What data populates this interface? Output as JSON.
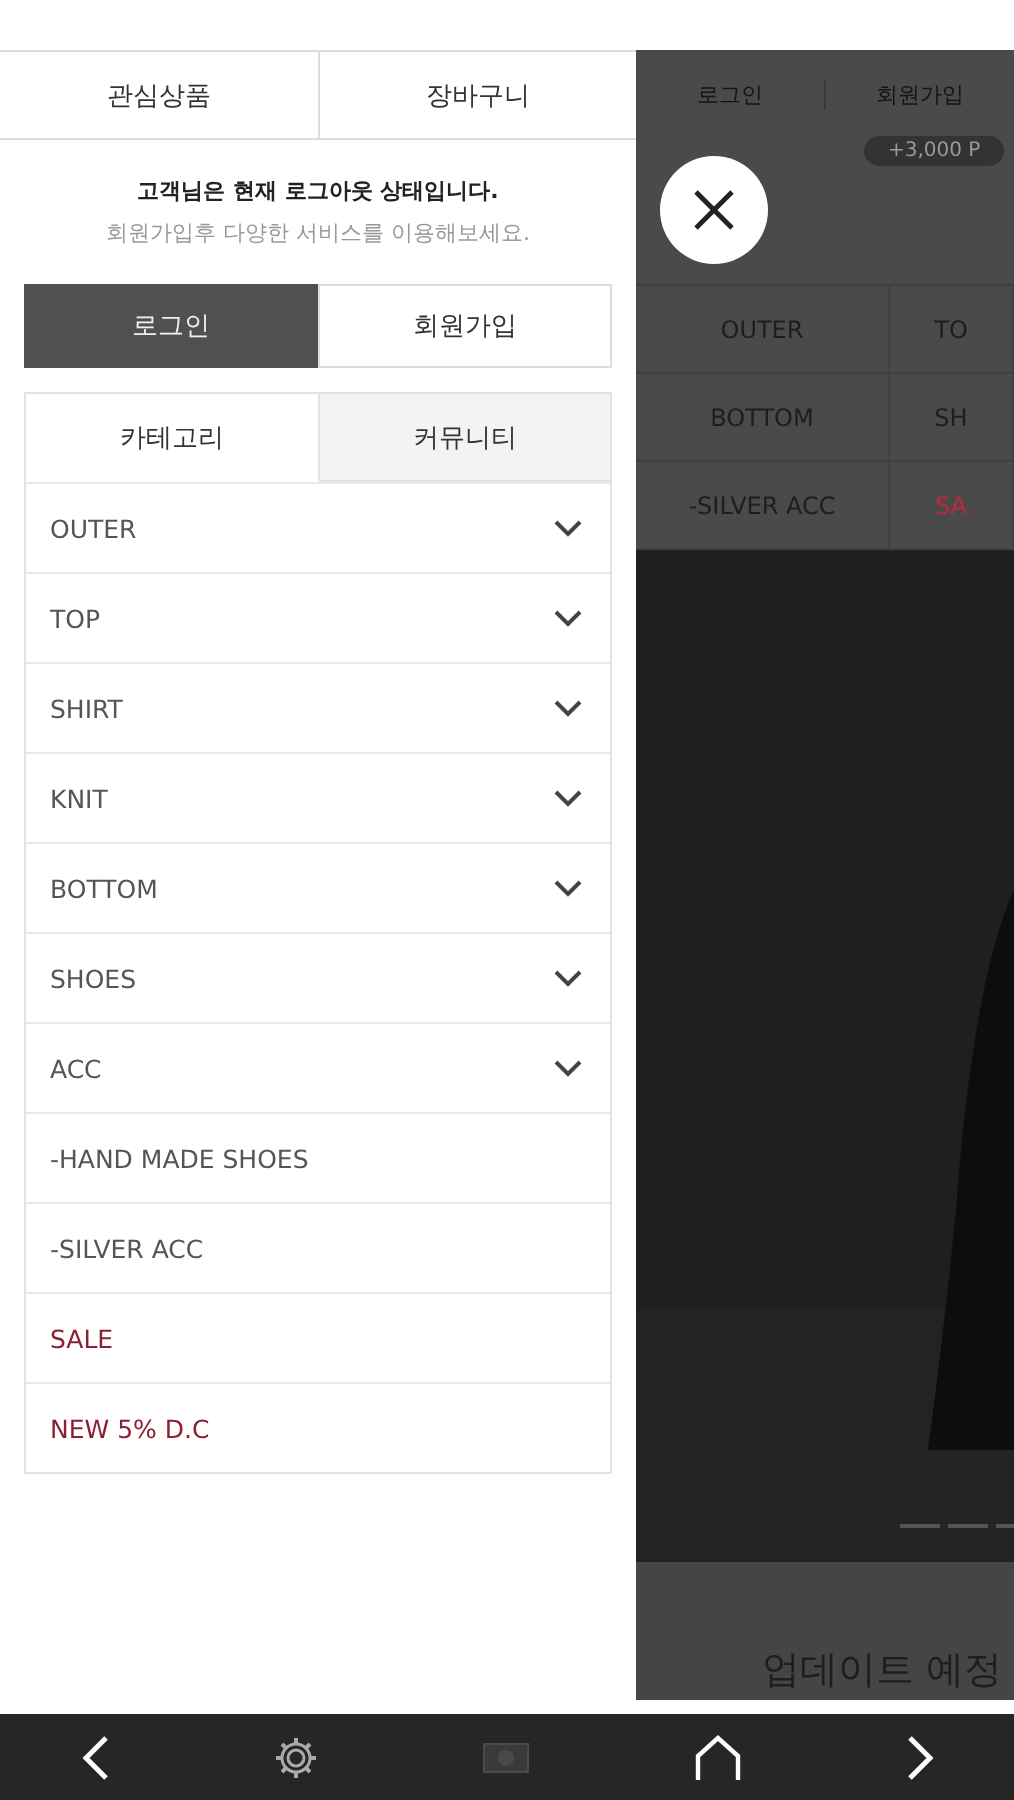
{
  "top_tabs": [
    {
      "label": "관심상품"
    },
    {
      "label": "장바구니"
    }
  ],
  "notice": {
    "status": "고객님은 현재 **로그아웃** 상태입니다.",
    "hint": "회원가입후 다양한 서비스를 이용해보세요."
  },
  "auth_buttons": [
    {
      "label": "로그인",
      "kind": "primary"
    },
    {
      "label": "회원가입",
      "kind": "secondary"
    }
  ],
  "menu_tabs": [
    {
      "label": "카테고리",
      "selected": true
    },
    {
      "label": "커뮤니티",
      "selected": false
    }
  ],
  "categories": [
    {
      "label": "OUTER",
      "expandable": true,
      "color": "#555555"
    },
    {
      "label": "TOP",
      "expandable": true,
      "color": "#555555"
    },
    {
      "label": "SHIRT",
      "expandable": true,
      "color": "#555555"
    },
    {
      "label": "KNIT",
      "expandable": true,
      "color": "#555555"
    },
    {
      "label": "BOTTOM",
      "expandable": true,
      "color": "#555555"
    },
    {
      "label": "SHOES",
      "expandable": true,
      "color": "#555555"
    },
    {
      "label": "ACC",
      "expandable": true,
      "color": "#555555"
    },
    {
      "label": "-HAND MADE SHOES",
      "expandable": false,
      "color": "#555555"
    },
    {
      "label": "-SILVER ACC",
      "expandable": false,
      "color": "#555555"
    },
    {
      "label": "SALE",
      "expandable": false,
      "color": "#8b2035"
    },
    {
      "label": "NEW 5% D.C",
      "expandable": false,
      "color": "#8b2035"
    }
  ],
  "background_page": {
    "nav": [
      "로그인",
      "회원가입"
    ],
    "points_badge": "+3,000 P",
    "grid": [
      {
        "label": "OUTER",
        "color": "#1e1e1e"
      },
      {
        "label": "TO",
        "color": "#1e1e1e"
      },
      {
        "label": "BOTTOM",
        "color": "#1e1e1e"
      },
      {
        "label": "SH",
        "color": "#1e1e1e"
      },
      {
        "label": "-SILVER ACC",
        "color": "#1e1e1e"
      },
      {
        "label": "SA",
        "color": "#c0283c"
      }
    ],
    "caption": "업데이트 예정"
  }
}
